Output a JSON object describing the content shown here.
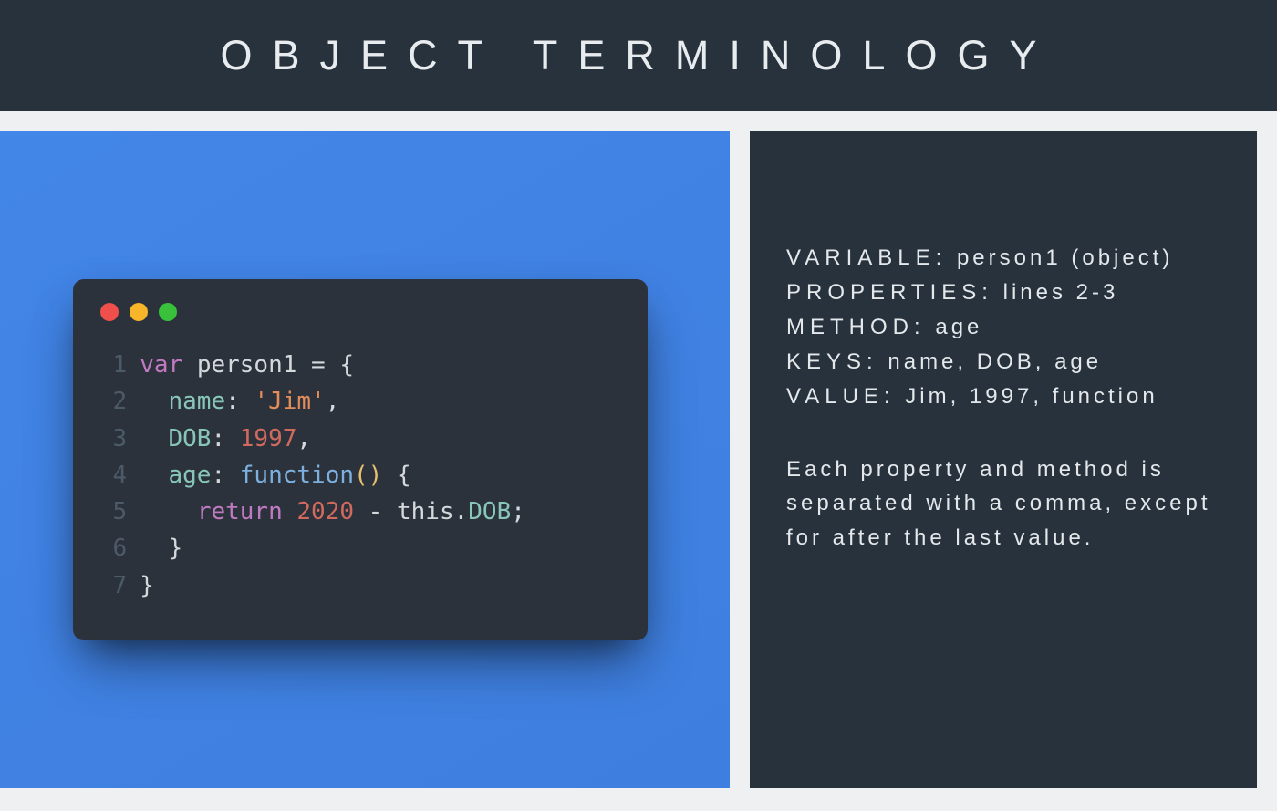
{
  "header": {
    "title": "OBJECT TERMINOLOGY"
  },
  "code": {
    "lines": {
      "n1": "1",
      "n2": "2",
      "n3": "3",
      "n4": "4",
      "n5": "5",
      "n6": "6",
      "n7": "7",
      "l1_var": "var",
      "l1_id": "person1",
      "l1_eq": " = ",
      "l1_brace": "{",
      "l2_indent": "  ",
      "l2_key": "name",
      "l2_colon": ": ",
      "l2_str": "'Jim'",
      "l2_comma": ",",
      "l3_indent": "  ",
      "l3_key": "DOB",
      "l3_colon": ": ",
      "l3_num": "1997",
      "l3_comma": ",",
      "l4_indent": "  ",
      "l4_key": "age",
      "l4_colon": ": ",
      "l4_fn": "function",
      "l4_par": "()",
      "l4_brace": " {",
      "l5_indent": "    ",
      "l5_ret": "return",
      "l5_sp": " ",
      "l5_num": "2020",
      "l5_minus": " - ",
      "l5_this": "this",
      "l5_dot": ".",
      "l5_dob": "DOB",
      "l5_semi": ";",
      "l6_indent": "  ",
      "l6_brace": "}",
      "l7_brace": "}"
    }
  },
  "terms": {
    "variable_label": "VARIABLE:",
    "variable_value": " person1 (object)",
    "properties_label": "PROPERTIES:",
    "properties_value": " lines 2-3",
    "method_label": "METHOD:",
    "method_value": " age",
    "keys_label": "KEYS:",
    "keys_value": " name, DOB, age",
    "value_label": "VALUE:",
    "value_value": " Jim, 1997, function"
  },
  "note": "Each property and method is separated with a comma, except for after the last value."
}
